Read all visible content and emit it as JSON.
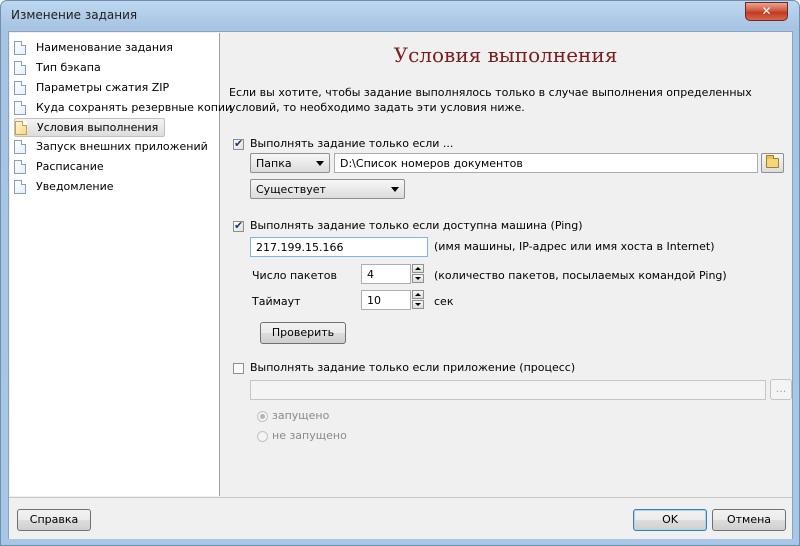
{
  "window": {
    "title": "Изменение задания",
    "close_label": "✕"
  },
  "sidebar": {
    "items": [
      {
        "label": "Наименование задания",
        "selected": false
      },
      {
        "label": "Тип бэкапа",
        "selected": false
      },
      {
        "label": "Параметры сжатия ZIP",
        "selected": false
      },
      {
        "label": "Куда сохранять резервные копии",
        "selected": false
      },
      {
        "label": "Условия выполнения",
        "selected": true
      },
      {
        "label": "Запуск внешних приложений",
        "selected": false
      },
      {
        "label": "Расписание",
        "selected": false
      },
      {
        "label": "Уведомление",
        "selected": false
      }
    ]
  },
  "main": {
    "heading": "Условия выполнения",
    "description": "Если вы хотите, чтобы задание выполнялось только в случае выполнения определенных условий, то необходимо задать эти условия ниже.",
    "condition_file": {
      "checkbox_label": "Выполнять задание только если ...",
      "checked": true,
      "type_value": "Папка",
      "path_value": "D:\\Список номеров документов",
      "state_value": "Существует"
    },
    "condition_ping": {
      "checkbox_label": "Выполнять задание только если доступна машина (Ping)",
      "checked": true,
      "host_value": "217.199.15.166",
      "host_hint": "(имя машины, IP-адрес или имя хоста в Internet)",
      "packets_label": "Число пакетов",
      "packets_value": "4",
      "packets_hint": "(количество пакетов, посылаемых командой Ping)",
      "timeout_label": "Таймаут",
      "timeout_value": "10",
      "timeout_unit": "сек",
      "check_button": "Проверить"
    },
    "condition_process": {
      "checkbox_label": "Выполнять задание только если приложение (процесс)",
      "checked": false,
      "process_value": "",
      "browse_label": "...",
      "radio_running": "запущено",
      "radio_not_running": "не запущено"
    }
  },
  "footer": {
    "help_button": "Справка",
    "ok_button": "OK",
    "cancel_button": "Отмена"
  }
}
